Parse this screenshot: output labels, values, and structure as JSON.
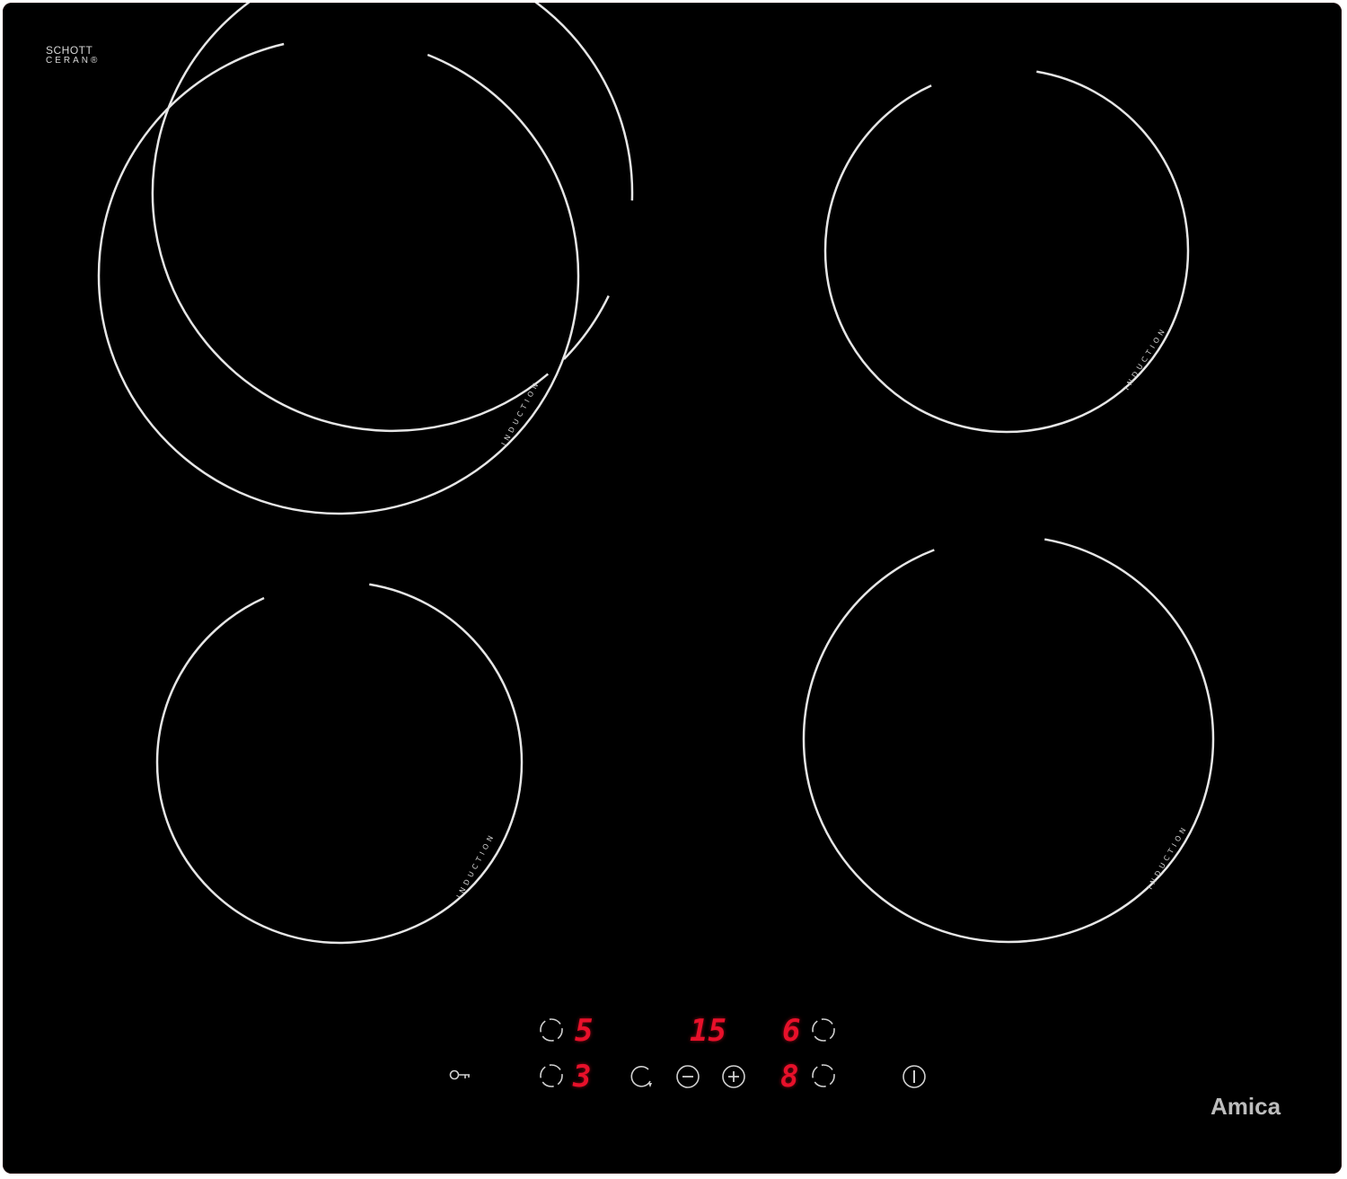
{
  "brand": {
    "schott_line1": "SCHOTT",
    "schott_line2": "CERAN®",
    "maker": "Amica"
  },
  "zones": [
    {
      "id": "front-left-large",
      "label": "INDUCTION"
    },
    {
      "id": "back-right",
      "label": "INDUCTION"
    },
    {
      "id": "rear-left",
      "label": "INDUCTION"
    },
    {
      "id": "rear-right",
      "label": "INDUCTION"
    }
  ],
  "displays": {
    "top_left": "5",
    "timer": "15",
    "top_right": "6",
    "bottom_left": "3",
    "bottom_right": "8"
  },
  "icons": {
    "lock": "key-lock-icon",
    "zone_select": "zone-select-icon",
    "timer": "timer-icon",
    "minus": "minus-icon",
    "plus": "plus-icon",
    "power": "power-icon"
  },
  "colors": {
    "glass": "#000000",
    "ring": "#e6e6e6",
    "display": "#e8102a",
    "control": "#d0d0d0"
  }
}
